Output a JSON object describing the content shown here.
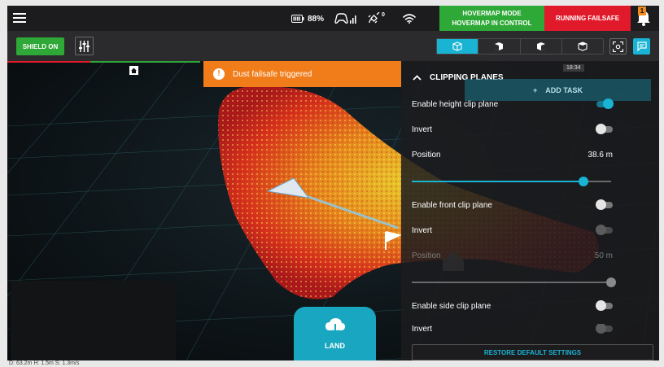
{
  "status_bar": {
    "battery_percent": "88%",
    "gps_count": "0",
    "hovermap_mode_line1": "HOVERMAP MODE",
    "hovermap_mode_line2": "HOVERMAP IN CONTROL",
    "failsafe_status": "RUNNING FAILSAFE",
    "notification_count": "1",
    "colors": {
      "mode_bg": "#2ea836",
      "failsafe_bg": "#e11a2b",
      "badge_bg": "#f08a1c"
    }
  },
  "toolbar": {
    "shield_label": "SHIELD ON",
    "view_buttons": [
      "perspective-view-icon",
      "front-view-icon",
      "side-view-icon",
      "top-view-icon"
    ],
    "active_view_index": 0,
    "accent": "#19b3d4"
  },
  "viewport": {
    "banner_text": "Dust failsafe triggered",
    "land_label": "LAND",
    "readout": "D: 63.2m   H: 1.5m   S: 1.3m/s"
  },
  "clipping": {
    "title": "CLIPPING PLANES",
    "timestamp": "18:34",
    "add_task_label": "ADD TASK",
    "height": {
      "enable_label": "Enable height clip plane",
      "enabled": true,
      "invert_label": "Invert",
      "invert": false,
      "position_label": "Position",
      "position_value": "38.6 m",
      "position_fraction": 0.86
    },
    "front": {
      "enable_label": "Enable front clip plane",
      "enabled": false,
      "invert_label": "Invert",
      "position_label": "Position",
      "position_value": "50 m",
      "position_fraction": 1.0
    },
    "side": {
      "enable_label": "Enable side clip plane",
      "enabled": false,
      "invert_label": "Invert"
    },
    "restore_label": "RESTORE DEFAULT SETTINGS"
  }
}
